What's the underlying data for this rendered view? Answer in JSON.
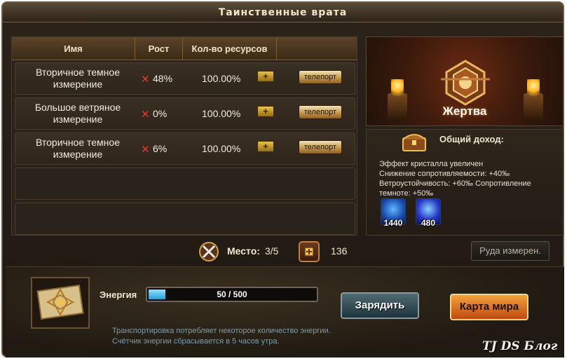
{
  "title": "Таинственные врата",
  "table": {
    "headers": {
      "name": "Имя",
      "growth": "Рост",
      "resources": "Кол-во ресурсов"
    },
    "rows": [
      {
        "name": "Вторичное темное измерение",
        "growth": "48%",
        "resources": "100.00%",
        "teleport": "телепорт"
      },
      {
        "name": "Большое ветряное измерение",
        "growth": "0%",
        "resources": "100.00%",
        "teleport": "телепорт"
      },
      {
        "name": "Вторичное темное измерение",
        "growth": "6%",
        "resources": "100.00%",
        "teleport": "телепорт"
      }
    ],
    "remove_glyph": "✕",
    "add_glyph": "+"
  },
  "sacrifice": {
    "label": "Жертва"
  },
  "income": {
    "title": "Общий доход:",
    "effects": [
      "Эффект кристалла увеличен",
      "Снижение сопротивляемости: +40‰",
      "Ветроустойчивость: +60‰  Сопротивление темноте: +50‰"
    ],
    "items": [
      {
        "icon": "ice-crystal-icon",
        "count": "1440"
      },
      {
        "icon": "sapphire-crystal-icon",
        "count": "480"
      }
    ]
  },
  "status": {
    "place_label": "Место:",
    "place_value": "3/5",
    "coins": "136",
    "ore_button": "Руда измерен."
  },
  "energy": {
    "label": "Энергия",
    "current": 50,
    "max": 500,
    "text": "50 / 500",
    "fill_fraction": 0.1
  },
  "buttons": {
    "charge": "Зарядить",
    "world_map": "Карта мира"
  },
  "note": [
    "Транспортировка потребляет некоторое количество энергии.",
    "Счётчик энергии сбрасывается в 5 часов утра."
  ],
  "watermark": "TJ DS Блог",
  "colors": {
    "accent": "#c59a4a",
    "energy": "#2a9ed4",
    "remove": "#e23b2b",
    "note": "#7d9cb0"
  }
}
